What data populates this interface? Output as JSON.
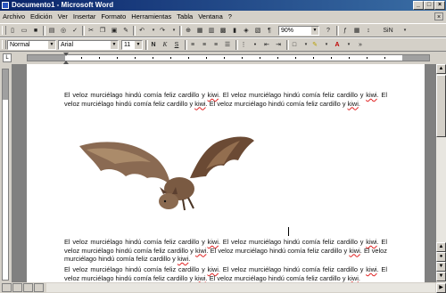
{
  "window": {
    "title": "Documento1 - Microsoft Word"
  },
  "menu": {
    "items": [
      "Archivo",
      "Edición",
      "Ver",
      "Insertar",
      "Formato",
      "Herramientas",
      "Tabla",
      "Ventana",
      "?"
    ]
  },
  "toolbar_standard": {
    "zoom": "90%",
    "sin_label": "SiN"
  },
  "toolbar_format": {
    "style": "Normal",
    "font": "Arial",
    "size": "11",
    "bold_label": "N",
    "italic_label": "K",
    "underline_label": "S"
  },
  "document": {
    "paragraphs": [
      "El veloz murciélago hindú comía feliz cardillo y kiwi.",
      "El veloz murciélago hindú comía feliz cardillo y kiwi.",
      "El veloz murciélago hindú comía feliz cardillo y kiwi.",
      "El veloz murciélago hindú comía feliz cardillo y kiwi.",
      "El veloz murciélago hindú comía feliz cardillo y kiwi."
    ]
  },
  "colors": {
    "titlebar_start": "#0a246a",
    "titlebar_end": "#3a6ea5",
    "spellcheck_underline": "#e02020"
  }
}
